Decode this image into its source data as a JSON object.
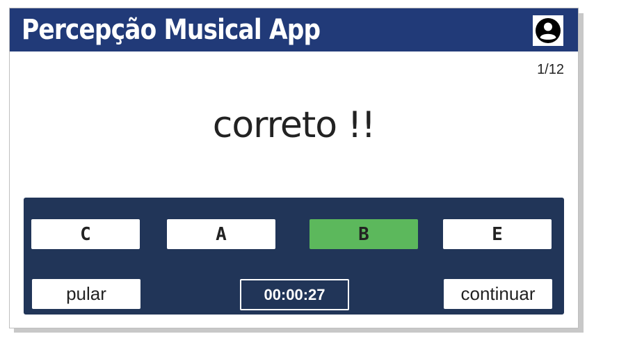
{
  "header": {
    "title": "Percepção Musical App",
    "profile_icon": "user-circle-icon"
  },
  "progress": {
    "counter": "1/12"
  },
  "feedback": {
    "message": "correto !!"
  },
  "options": [
    {
      "label": "C",
      "selected": false
    },
    {
      "label": "A",
      "selected": false
    },
    {
      "label": "B",
      "selected": true
    },
    {
      "label": "E",
      "selected": false
    }
  ],
  "controls": {
    "skip_label": "pular",
    "timer": "00:00:27",
    "continue_label": "continuar"
  },
  "colors": {
    "header_bg": "#213a78",
    "panel_bg": "#213558",
    "selected_option": "#5cb85c"
  }
}
